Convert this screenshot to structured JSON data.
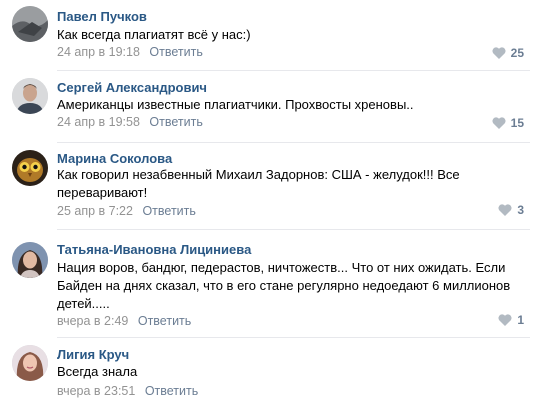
{
  "comments": [
    {
      "author": "Павел Пучков",
      "text": "Как всегда плагиатят всё у нас:)",
      "date": "24 апр в 19:18",
      "reply_label": "Ответить",
      "likes": "25"
    },
    {
      "author": "Сергей Александрович",
      "text": "Американцы известные плагиатчики. Прохвосты хреновы..",
      "date": "24 апр в 19:58",
      "reply_label": "Ответить",
      "likes": "15"
    },
    {
      "author": "Марина Соколова",
      "text": "Как говорил незабвенный Михаил Задорнов: США - желудок!!! Все переваривают!",
      "date": "25 апр в 7:22",
      "reply_label": "Ответить",
      "likes": "3"
    },
    {
      "author": "Татьяна-Ивановна Лициниева",
      "text": "Нация воров, бандюг, педерастов, ничтожеств... Что от них ожидать. Если Байден на днях сказал, что в его стане регулярно недоедают 6 миллионов детей.....",
      "date": "вчера в 2:49",
      "reply_label": "Ответить",
      "likes": "1"
    },
    {
      "author": "Лигия Круч",
      "text": "Всегда знала",
      "date": "вчера в 23:51",
      "reply_label": "Ответить",
      "likes": ""
    }
  ],
  "colors": {
    "author": "#2a5885",
    "meta": "#939393",
    "reply": "#6b7d93",
    "divider": "#e7e8ec"
  },
  "icons": {
    "like": "heart-icon"
  }
}
